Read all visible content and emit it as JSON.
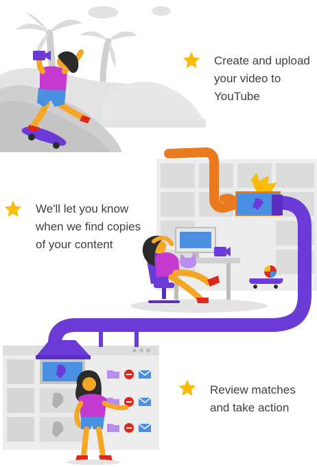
{
  "steps": [
    {
      "lines": [
        "Create and upload",
        "your video to",
        "YouTube"
      ],
      "icon": "star-icon"
    },
    {
      "lines": [
        "We'll let you know",
        "when we find copies",
        "of your content"
      ],
      "icon": "star-icon"
    },
    {
      "lines": [
        "Review matches",
        "and take action"
      ],
      "icon": "star-icon"
    }
  ],
  "colors": {
    "text": "#3c4043",
    "star": "#fbbc04",
    "purple": "#6c3ad6",
    "orange": "#ea7a1e",
    "magenta": "#c43ad0",
    "blue": "#4a90e2",
    "gray_light": "#ececec",
    "gray_mid": "#d6d6d6",
    "red": "#e0261b"
  }
}
